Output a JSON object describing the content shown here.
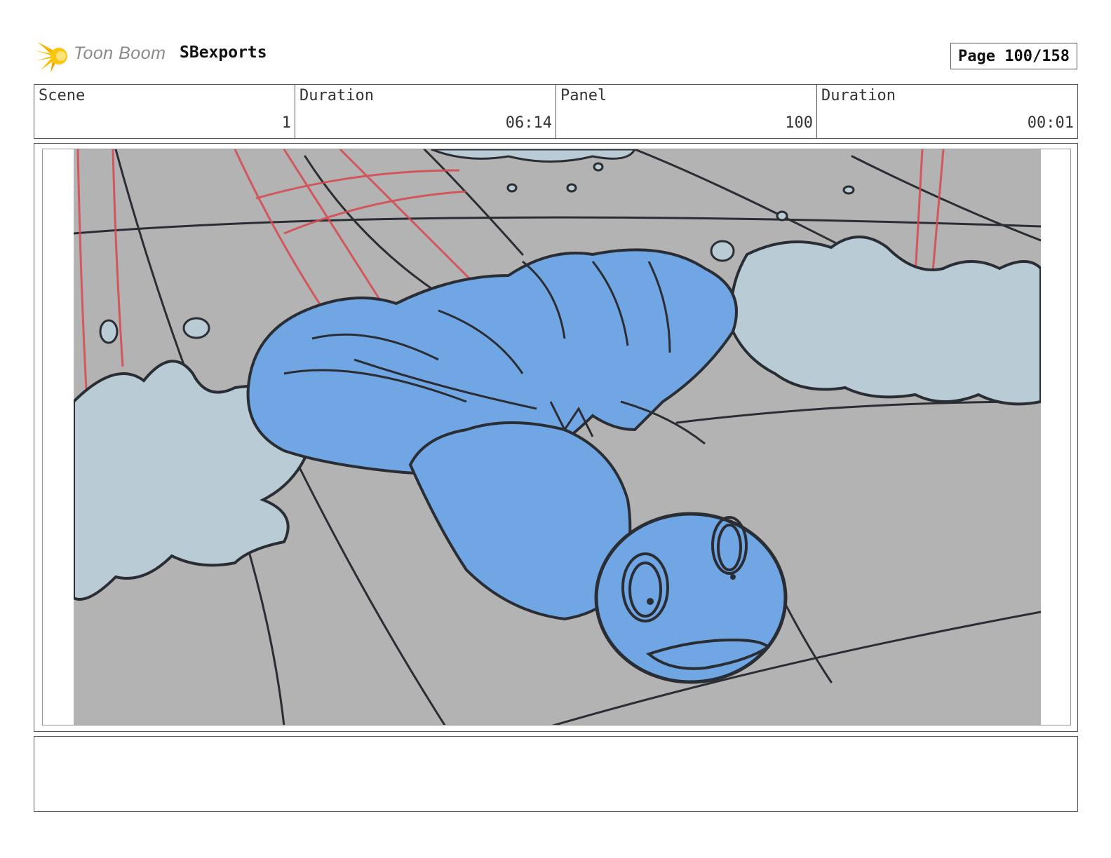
{
  "header": {
    "logo_text": "Toon Boom",
    "project": "SBexports",
    "page_label": "Page 100/158"
  },
  "info": {
    "scene_label": "Scene",
    "scene_value": "1",
    "duration_label": "Duration",
    "duration_value": "06:14",
    "panel_label": "Panel",
    "panel_value": "100",
    "panel_duration_label": "Duration",
    "panel_duration_value": "00:01"
  },
  "colors": {
    "floor": "#b3b3b3",
    "character_fill": "#6fa6e3",
    "splash_fill": "#b9cbd4",
    "red_lines": "#d8484f",
    "sketch_lines": "#2a2d33"
  },
  "notes": ""
}
